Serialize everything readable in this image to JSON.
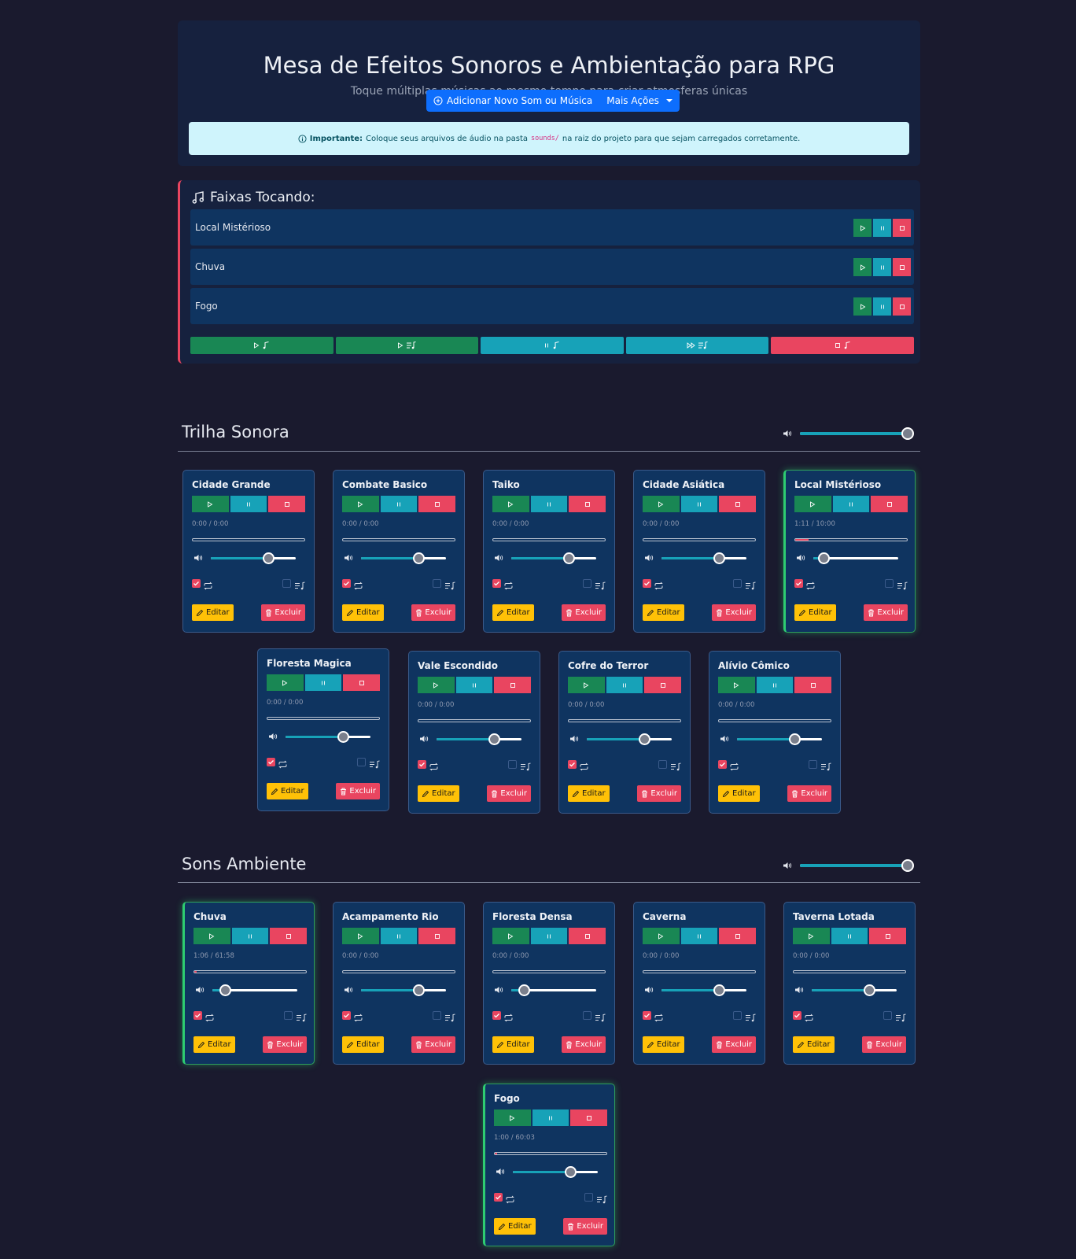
{
  "header": {
    "title": "Mesa de Efeitos Sonoros e Ambientação para RPG",
    "subtitle": "Toque múltiplas músicas ao mesmo tempo para criar atmosferas únicas",
    "add_button": "Adicionar Novo Som ou Música",
    "more_actions": "Mais Ações",
    "alert": {
      "strong": "Importante:",
      "text_before": "Coloque seus arquivos de áudio na pasta",
      "folder": "sounds/",
      "text_after": "na raiz do projeto para que sejam carregados corretamente."
    }
  },
  "playing": {
    "title": "Faixas Tocando:",
    "tracks": [
      {
        "name": "Local Mistérioso"
      },
      {
        "name": "Chuva"
      },
      {
        "name": "Fogo"
      }
    ]
  },
  "sections": {
    "soundtrack": {
      "title": "Trilha Sonora",
      "master_volume": 1.0
    },
    "ambient": {
      "title": "Sons Ambiente",
      "master_volume": 1.0
    }
  },
  "labels": {
    "edit": "Editar",
    "delete": "Excluir"
  },
  "soundtrack_cards": [
    {
      "name": "Cidade Grande",
      "time": "0:00 / 0:00",
      "progress": 0,
      "volume": 0.68,
      "loop": true,
      "queue": false,
      "active": false
    },
    {
      "name": "Combate Basico",
      "time": "0:00 / 0:00",
      "progress": 0,
      "volume": 0.68,
      "loop": true,
      "queue": false,
      "active": false
    },
    {
      "name": "Taiko",
      "time": "0:00 / 0:00",
      "progress": 0,
      "volume": 0.68,
      "loop": true,
      "queue": false,
      "active": false
    },
    {
      "name": "Cidade Asiática",
      "time": "0:00 / 0:00",
      "progress": 0,
      "volume": 0.68,
      "loop": true,
      "queue": false,
      "active": false
    },
    {
      "name": "Local Mistérioso",
      "time": "1:11 / 10:00",
      "progress": 0.12,
      "volume": 0.12,
      "loop": true,
      "queue": false,
      "active": true
    },
    {
      "name": "Floresta Magica",
      "time": "0:00 / 0:00",
      "progress": 0,
      "volume": 0.68,
      "loop": true,
      "queue": false,
      "active": false
    },
    {
      "name": "Vale Escondido",
      "time": "0:00 / 0:00",
      "progress": 0,
      "volume": 0.68,
      "loop": true,
      "queue": false,
      "active": false
    },
    {
      "name": "Cofre do Terror",
      "time": "0:00 / 0:00",
      "progress": 0,
      "volume": 0.68,
      "loop": true,
      "queue": false,
      "active": false
    },
    {
      "name": "Alívio Cômico",
      "time": "0:00 / 0:00",
      "progress": 0,
      "volume": 0.68,
      "loop": true,
      "queue": false,
      "active": false
    }
  ],
  "ambient_cards": [
    {
      "name": "Chuva",
      "time": "1:06 / 61:58",
      "progress": 0.02,
      "volume": 0.15,
      "loop": true,
      "queue": false,
      "active": true
    },
    {
      "name": "Acampamento Rio",
      "time": "0:00 / 0:00",
      "progress": 0,
      "volume": 0.68,
      "loop": true,
      "queue": false,
      "active": false
    },
    {
      "name": "Floresta Densa",
      "time": "0:00 / 0:00",
      "progress": 0,
      "volume": 0.15,
      "loop": true,
      "queue": false,
      "active": false
    },
    {
      "name": "Caverna",
      "time": "0:00 / 0:00",
      "progress": 0,
      "volume": 0.68,
      "loop": true,
      "queue": false,
      "active": false
    },
    {
      "name": "Taverna Lotada",
      "time": "0:00 / 0:00",
      "progress": 0,
      "volume": 0.68,
      "loop": true,
      "queue": false,
      "active": false
    },
    {
      "name": "Fogo",
      "time": "1:00 / 60:03",
      "progress": 0.02,
      "volume": 0.68,
      "loop": true,
      "queue": false,
      "active": true
    }
  ],
  "colors": {
    "background": "#1a1a2e",
    "panel": "#16213e",
    "card": "#0f3460",
    "success": "#198754",
    "info": "#17a2b8",
    "danger": "#e94560",
    "warning": "#ffc107",
    "primary": "#0d6efd",
    "active_glow": "#2ecc71"
  },
  "icons": {
    "play": "play-icon",
    "pause": "pause-icon",
    "stop": "stop-icon",
    "volume": "volume-icon",
    "loop": "loop-icon",
    "queue": "queue-icon",
    "edit": "pencil-icon",
    "delete": "trash-icon",
    "music": "music-note-icon",
    "info": "info-circle-icon",
    "add": "plus-circle-icon"
  }
}
